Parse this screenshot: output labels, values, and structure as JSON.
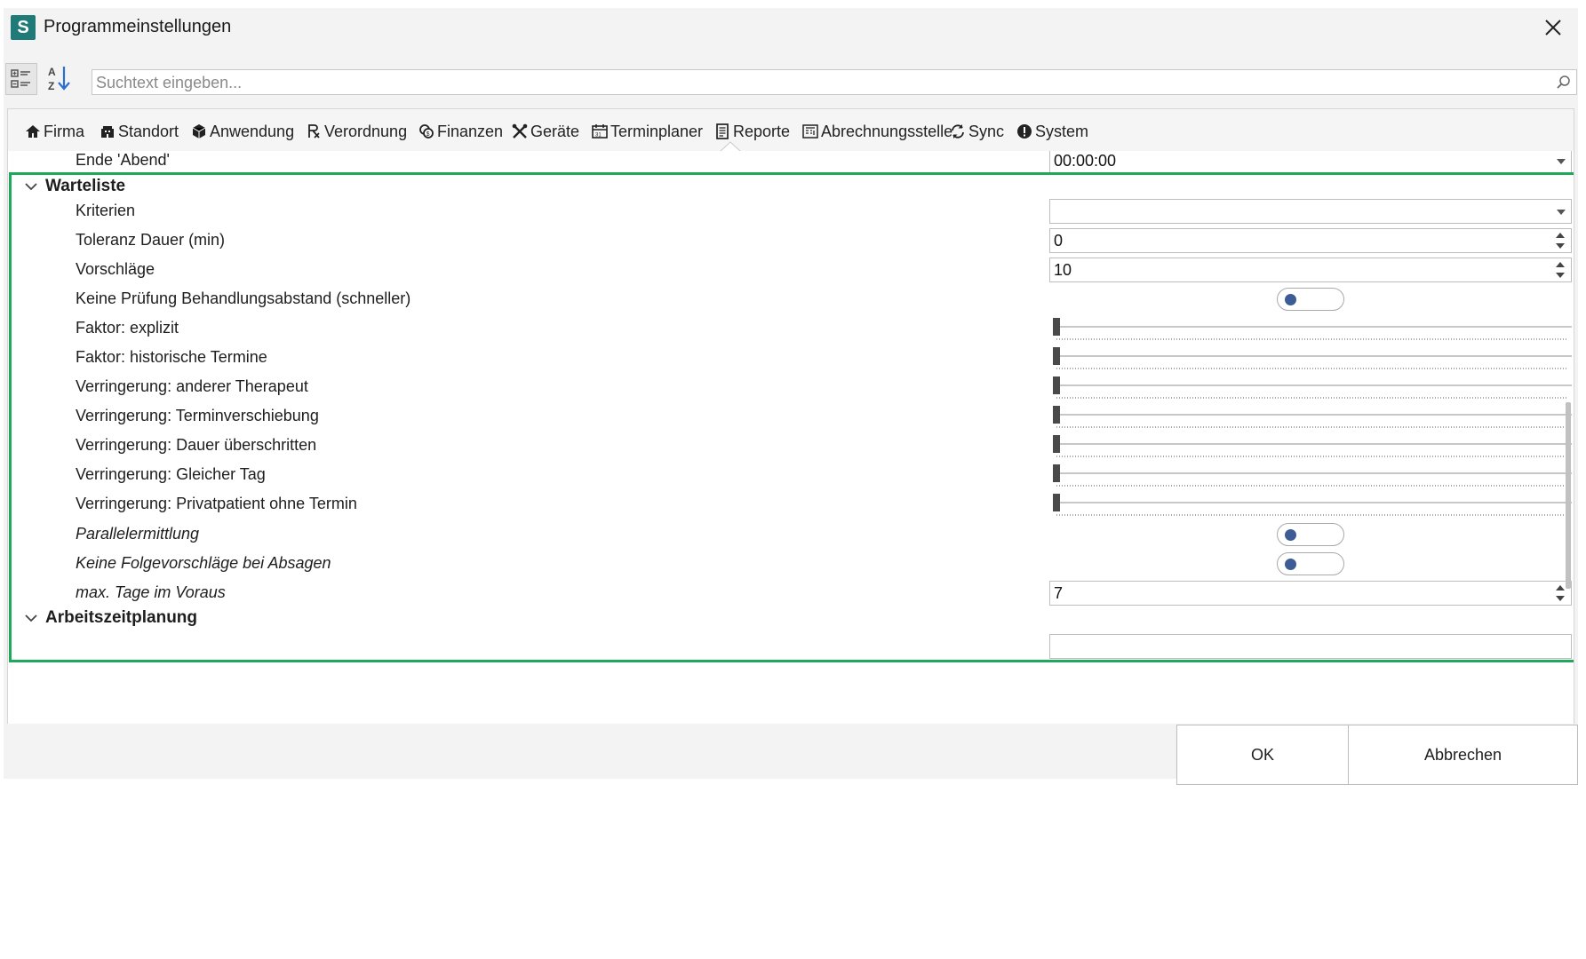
{
  "window": {
    "app_icon_letter": "S",
    "title": "Programmeinstellungen"
  },
  "toolbar": {
    "search_placeholder": "Suchtext eingeben..."
  },
  "tabs": [
    {
      "label": "Firma",
      "icon": "home-icon"
    },
    {
      "label": "Standort",
      "icon": "building-icon"
    },
    {
      "label": "Anwendung",
      "icon": "box-icon"
    },
    {
      "label": "Verordnung",
      "icon": "prescription-icon"
    },
    {
      "label": "Finanzen",
      "icon": "coins-icon"
    },
    {
      "label": "Geräte",
      "icon": "tools-icon"
    },
    {
      "label": "Terminplaner",
      "icon": "calendar-icon",
      "active": true
    },
    {
      "label": "Reporte",
      "icon": "report-icon"
    },
    {
      "label": "Abrechnungsstelle",
      "icon": "billing-icon"
    },
    {
      "label": "Sync",
      "icon": "sync-icon"
    },
    {
      "label": "System",
      "icon": "info-icon"
    }
  ],
  "settings": {
    "ende_abend": {
      "label": "Ende 'Abend'",
      "value": "00:00:00"
    },
    "warteliste": {
      "header": "Warteliste",
      "kriterien": {
        "label": "Kriterien",
        "value": ""
      },
      "toleranz": {
        "label": "Toleranz Dauer (min)",
        "value": "0"
      },
      "vorschlaege": {
        "label": "Vorschläge",
        "value": "10"
      },
      "keine_pruefung": {
        "label": "Keine Prüfung Behandlungsabstand (schneller)",
        "checked": false
      },
      "sliders": [
        {
          "label": "Faktor: explizit",
          "value": 0
        },
        {
          "label": "Faktor: historische Termine",
          "value": 0
        },
        {
          "label": "Verringerung: anderer Therapeut",
          "value": 0
        },
        {
          "label": "Verringerung: Terminverschiebung",
          "value": 0
        },
        {
          "label": "Verringerung: Dauer überschritten",
          "value": 0
        },
        {
          "label": "Verringerung: Gleicher Tag",
          "value": 0
        },
        {
          "label": "Verringerung: Privatpatient ohne Termin",
          "value": 0
        }
      ],
      "parallelermittlung": {
        "label": "Parallelermittlung",
        "checked": false
      },
      "keine_folgevorschlaege": {
        "label": "Keine Folgevorschläge bei Absagen",
        "checked": false
      },
      "max_tage": {
        "label": "max. Tage im Voraus",
        "value": "7"
      }
    },
    "arbeitszeitplanung": {
      "header": "Arbeitszeitplanung"
    }
  },
  "footer": {
    "ok_label": "OK",
    "cancel_label": "Abbrechen"
  },
  "colors": {
    "accent_green": "#1ea85a",
    "toggle_knob": "#3d5c96",
    "app_icon": "#1f7a78"
  }
}
